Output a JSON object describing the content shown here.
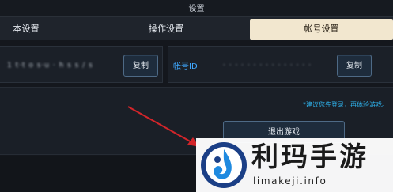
{
  "window": {
    "title": "设置"
  },
  "tabs": [
    {
      "label": "本设置",
      "active": false
    },
    {
      "label": "操作设置",
      "active": false
    },
    {
      "label": "帐号设置",
      "active": true
    }
  ],
  "account": {
    "name_value": "1 t·t o s·u · h s s / s · C",
    "copy_label": "复制",
    "id_label": "帐号ID",
    "id_value": "· · · · · · · · · · · · · · ·",
    "id_copy_label": "复制"
  },
  "panel": {
    "hint": "*建议您先登录，再体验游戏。",
    "exit_label": "退出游戏"
  },
  "watermark": {
    "cn_text": "利玛手游",
    "url_text": "limakeji.info"
  },
  "colors": {
    "accent_blue": "#3fa8ff",
    "active_tab": "#f2e7cf",
    "arrow": "#d3252a"
  }
}
